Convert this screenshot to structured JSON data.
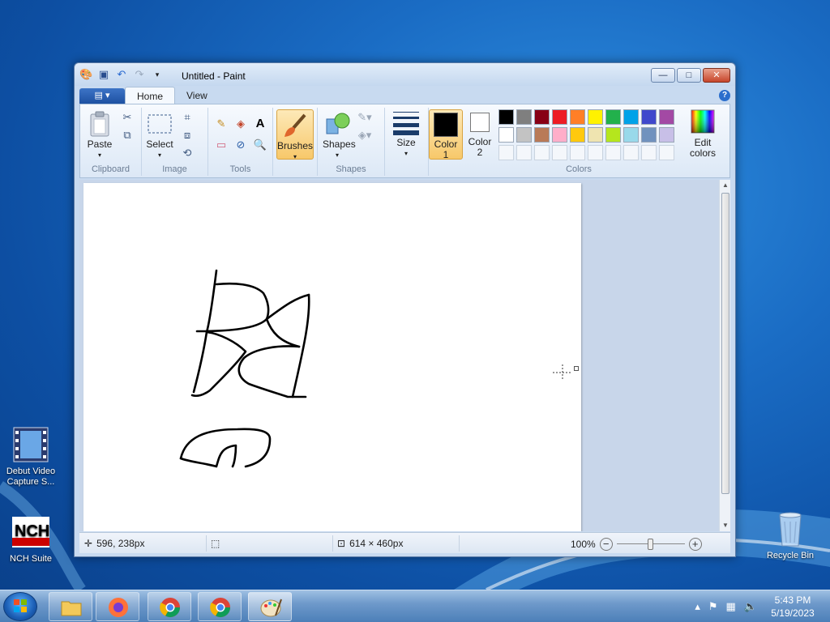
{
  "window": {
    "title": "Untitled - Paint",
    "controls": {
      "minimize": "—",
      "maximize": "□",
      "close": "✕"
    }
  },
  "ribbon": {
    "file_menu": "▤ ▾",
    "tabs": [
      "Home",
      "View"
    ],
    "help": "?",
    "groups": {
      "clipboard": {
        "label": "Clipboard",
        "paste": "Paste"
      },
      "image": {
        "label": "Image",
        "select": "Select"
      },
      "tools": {
        "label": "Tools"
      },
      "brushes": {
        "label": "Brushes"
      },
      "shapes": {
        "label": "Shapes",
        "shapes_btn": "Shapes"
      },
      "size": {
        "label": "Size"
      },
      "colors": {
        "label": "Colors",
        "color1": "Color\n1",
        "color1_a": "Color",
        "color1_b": "1",
        "color2_a": "Color",
        "color2_b": "2",
        "edit_a": "Edit",
        "edit_b": "colors",
        "palette_row1": [
          "#000000",
          "#7f7f7f",
          "#880015",
          "#ed1c24",
          "#ff7f27",
          "#fff200",
          "#22b14c",
          "#00a2e8",
          "#3f48cc",
          "#a349a4"
        ],
        "palette_row2": [
          "#ffffff",
          "#c3c3c3",
          "#b97a57",
          "#ffaec9",
          "#ffc90e",
          "#efe4b0",
          "#b5e61d",
          "#99d9ea",
          "#7092be",
          "#c8bfe7"
        ]
      }
    }
  },
  "status": {
    "cursor_pos": "596, 238px",
    "canvas_size": "614 × 460px",
    "zoom": "100%"
  },
  "desktop": {
    "icons": [
      {
        "label": "Debut Video Capture S..."
      },
      {
        "label": "NCH Suite"
      },
      {
        "label": "Recycle Bin"
      }
    ]
  },
  "taskbar": {
    "time": "5:43 PM",
    "date": "5/19/2023"
  }
}
